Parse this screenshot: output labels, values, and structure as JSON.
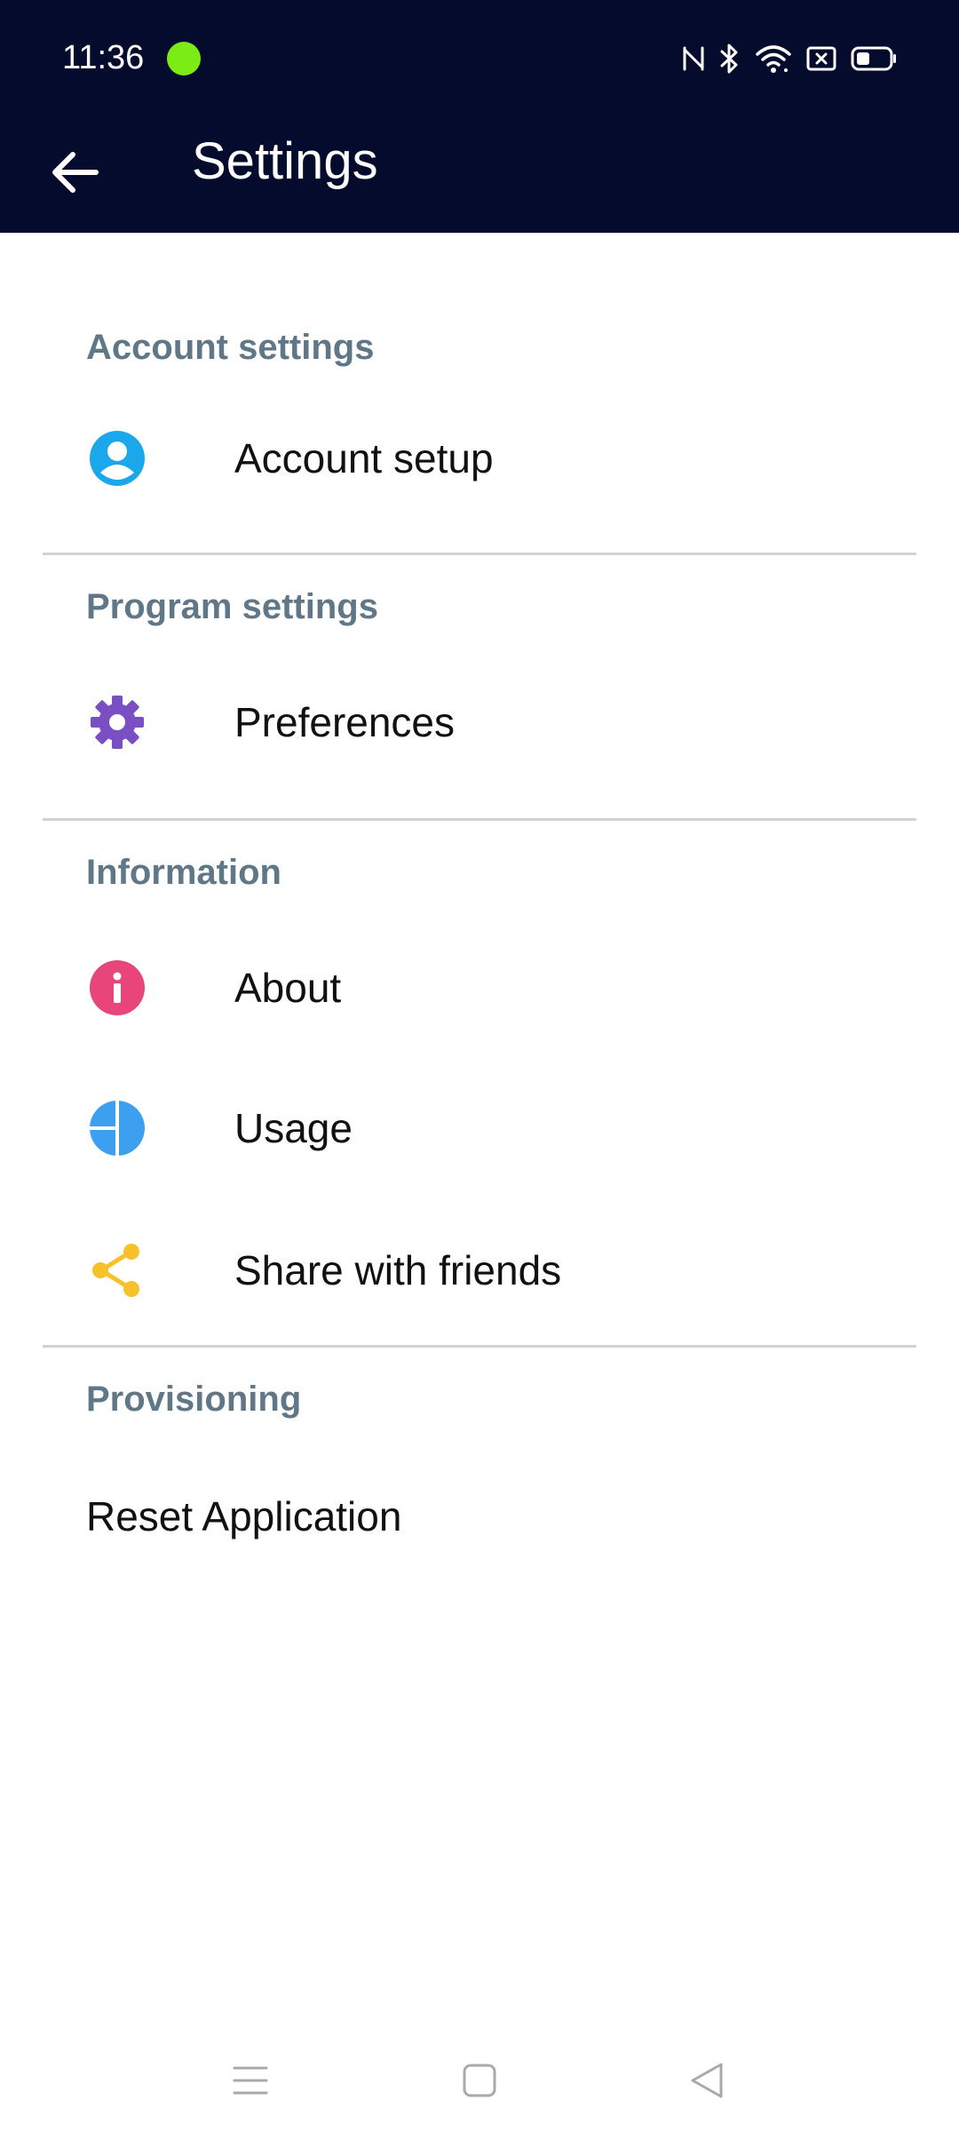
{
  "status_bar": {
    "time": "11:36",
    "indicator_color": "#7bed15",
    "icons": [
      "nfc-icon",
      "bluetooth-icon",
      "wifi-icon",
      "sim-icon",
      "battery-icon"
    ]
  },
  "toolbar": {
    "back_icon": "arrow-left-icon",
    "title": "Settings",
    "background": "#050b2c"
  },
  "sections": {
    "account": {
      "header": "Account settings",
      "items": [
        {
          "label": "Account setup",
          "icon": "account-circle-icon",
          "color": "#1aa7ec"
        }
      ]
    },
    "program": {
      "header": "Program settings",
      "items": [
        {
          "label": "Preferences",
          "icon": "gear-icon",
          "color": "#7a4fc4"
        }
      ]
    },
    "information": {
      "header": "Information",
      "items": [
        {
          "label": "About",
          "icon": "info-icon",
          "color": "#e8457a"
        },
        {
          "label": "Usage",
          "icon": "pie-chart-icon",
          "color": "#3d9fef"
        },
        {
          "label": "Share with friends",
          "icon": "share-icon",
          "color": "#f7c12a"
        }
      ]
    },
    "provisioning": {
      "header": "Provisioning",
      "items": [
        {
          "label": "Reset Application"
        }
      ]
    }
  },
  "nav_bar": {
    "icons": [
      "menu-icon",
      "home-square-icon",
      "back-triangle-icon"
    ]
  }
}
